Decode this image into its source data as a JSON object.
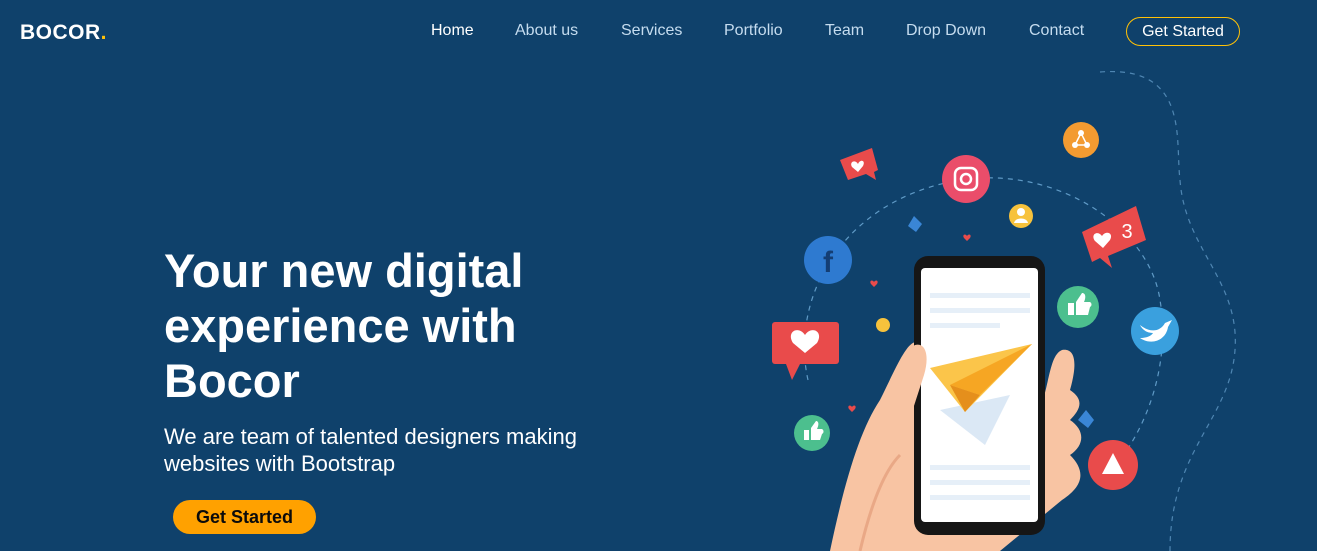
{
  "brand": {
    "name": "BOCOR",
    "dot": ".",
    "accent": "#ffc107"
  },
  "nav": {
    "items": [
      {
        "label": "Home",
        "active": true
      },
      {
        "label": "About us",
        "active": false
      },
      {
        "label": "Services",
        "active": false
      },
      {
        "label": "Portfolio",
        "active": false
      },
      {
        "label": "Team",
        "active": false
      },
      {
        "label": "Drop Down",
        "active": false
      },
      {
        "label": "Contact",
        "active": false
      }
    ],
    "cta": "Get Started"
  },
  "hero": {
    "title": "Your new digital experience with Bocor",
    "subtitle": "We are team of talented designers making websites with Bootstrap",
    "cta": "Get Started"
  },
  "illustration": {
    "badge_count": "3",
    "icons": [
      "facebook-icon",
      "instagram-icon",
      "twitter-icon",
      "share-icon",
      "like-icon",
      "heart-icon",
      "user-icon",
      "play-icon",
      "paper-plane-icon"
    ]
  },
  "colors": {
    "background": "#0f416b",
    "button": "#ffa100",
    "outline": "#ffc107"
  }
}
